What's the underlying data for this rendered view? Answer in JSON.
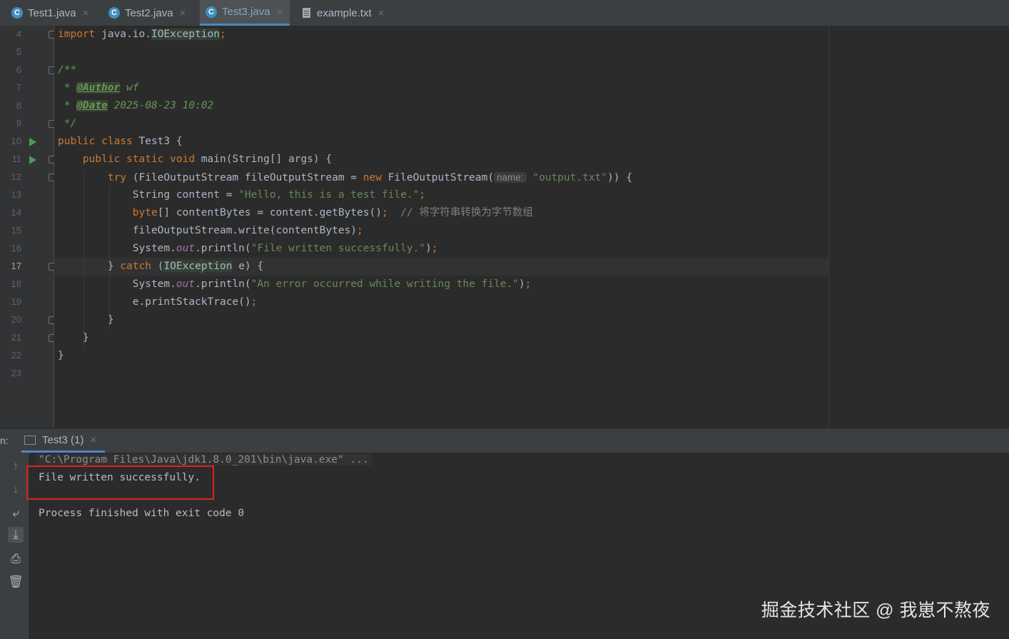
{
  "tabs": [
    {
      "label": "Test1.java",
      "icon": "java-class-icon",
      "active": false
    },
    {
      "label": "Test2.java",
      "icon": "java-class-icon",
      "active": false
    },
    {
      "label": "Test3.java",
      "icon": "java-class-icon",
      "active": true
    },
    {
      "label": "example.txt",
      "icon": "text-file-icon",
      "active": false
    }
  ],
  "editor": {
    "line_numbers": [
      "4",
      "5",
      "6",
      "7",
      "8",
      "9",
      "10",
      "11",
      "12",
      "13",
      "14",
      "15",
      "16",
      "17",
      "18",
      "19",
      "20",
      "21",
      "22",
      "23"
    ],
    "current_line": "17",
    "code": {
      "l4_kw": "import",
      "l4_pkg": " java.io.",
      "l4_cls": "IOException",
      "l4_semi": ";",
      "l6": "/**",
      "l7_star": " * ",
      "l7_tag": "@Author",
      "l7_val": " wf",
      "l8_star": " * ",
      "l8_tag": "@Date",
      "l8_val": " 2025-08-23 10:02",
      "l9": " */",
      "l10_kw": "public class",
      "l10_rest": " Test3 {",
      "l11_kw": "    public static void",
      "l11_rest": " main(String[] args) {",
      "l12_kw": "        try",
      "l12_mid": " (FileOutputStream fileOutputStream = ",
      "l12_new": "new",
      "l12_cls": " FileOutputStream(",
      "l12_hint": "name:",
      "l12_str": "\"output.txt\"",
      "l12_end": ")) {",
      "l13_pre": "            String content = ",
      "l13_str": "\"Hello, this is a test file.\"",
      "l13_semi": ";",
      "l14_kw": "            byte",
      "l14_mid": "[] contentBytes = content.getBytes()",
      "l14_semi": ";",
      "l14_cmt": "  // 将字符串转换为字节数组",
      "l15_pre": "            fileOutputStream.write(contentBytes)",
      "l15_semi": ";",
      "l16_pre": "            System.",
      "l16_out": "out",
      "l16_mid": ".println(",
      "l16_str": "\"File written successfully.\"",
      "l16_end": ")",
      "l16_semi": ";",
      "l17_pre": "        } ",
      "l17_kw": "catch",
      "l17_mid": " (",
      "l17_cls_a": "IOExce",
      "l17_cls_b": "ption",
      "l17_end": " e) {",
      "l18_pre": "            System.",
      "l18_out": "out",
      "l18_mid": ".println(",
      "l18_str": "\"An error occurred while writing the file.\"",
      "l18_end": ")",
      "l18_semi": ";",
      "l19_pre": "            e.printStackTrace()",
      "l19_semi": ";",
      "l20": "        }",
      "l21": "    }",
      "l22": "}"
    }
  },
  "run_panel": {
    "prefix": "n:",
    "tab_label": "Test3 (1)",
    "command": "\"C:\\Program Files\\Java\\jdk1.8.0_201\\bin\\java.exe\" ...",
    "output": "File written successfully.",
    "exit": "Process finished with exit code 0",
    "tools": [
      "up-arrow-icon",
      "down-arrow-icon",
      "soft-wrap-icon",
      "scroll-to-end-icon",
      "print-icon",
      "trash-icon"
    ]
  },
  "watermark": "掘金技术社区 @ 我崽不熬夜",
  "colors": {
    "keyword": "#cc7832",
    "string": "#6a8759",
    "comment": "#629755",
    "field": "#9876aa",
    "text": "#a9b7c6",
    "background": "#2b2b2b",
    "highlight_box": "#e02020"
  }
}
